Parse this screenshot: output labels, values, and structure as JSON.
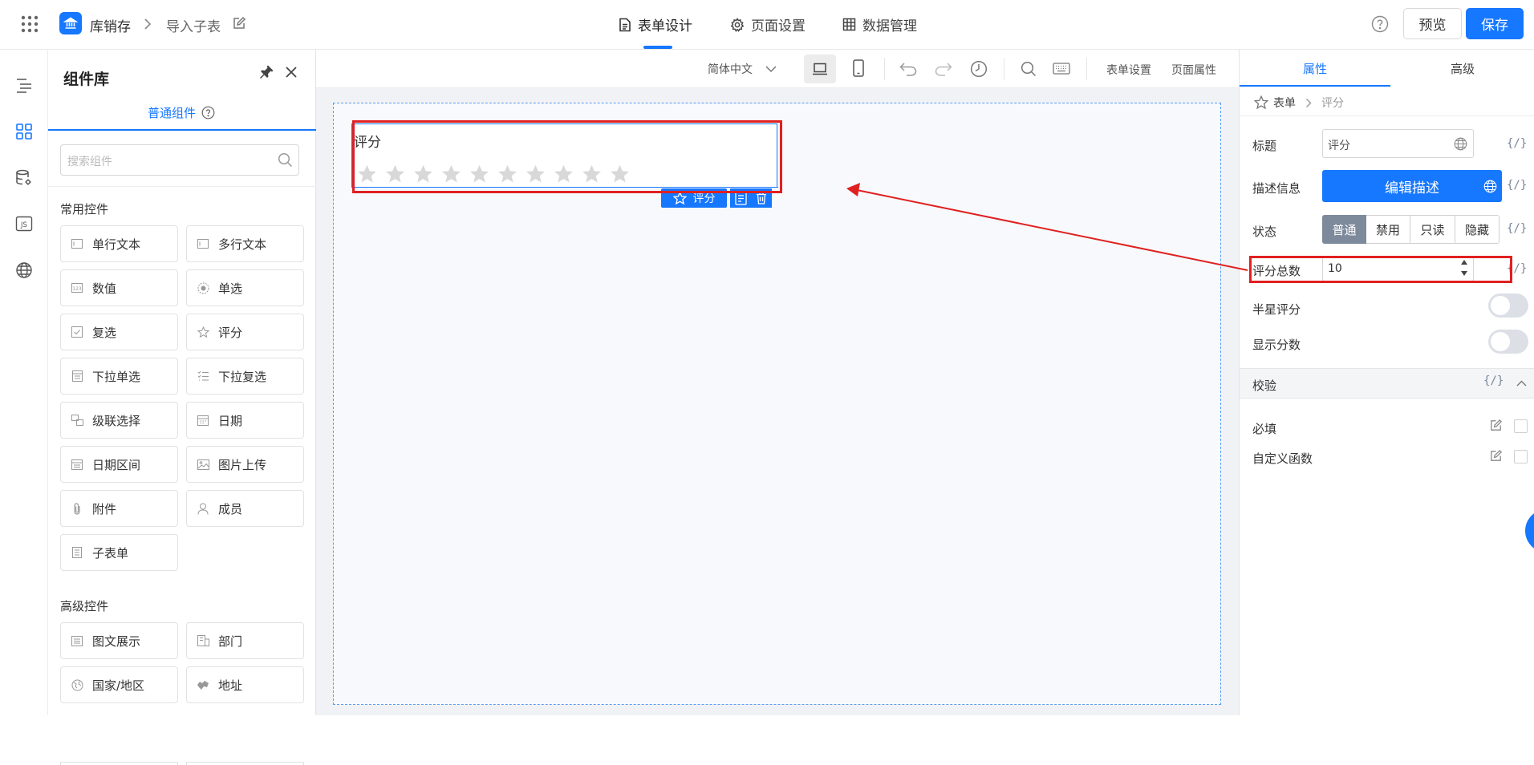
{
  "header": {
    "app_name": "库销存",
    "breadcrumb_page": "导入子表",
    "tabs": [
      {
        "label": "表单设计",
        "icon": "document-icon",
        "active": true
      },
      {
        "label": "页面设置",
        "icon": "gear-icon",
        "active": false
      },
      {
        "label": "数据管理",
        "icon": "table-icon",
        "active": false
      }
    ],
    "preview_label": "预览",
    "save_label": "保存",
    "accent": "#1677ff"
  },
  "library": {
    "title": "组件库",
    "tab_label": "普通组件",
    "search_placeholder": "搜索组件",
    "common_title": "常用控件",
    "common_items": [
      "单行文本",
      "多行文本",
      "数值",
      "单选",
      "复选",
      "评分",
      "下拉单选",
      "下拉复选",
      "级联选择",
      "日期",
      "日期区间",
      "图片上传",
      "附件",
      "成员",
      "子表单"
    ],
    "advanced_title": "高级控件",
    "advanced_items": [
      "图文展示",
      "部门",
      "国家/地区",
      "地址"
    ]
  },
  "toolbar": {
    "language": "简体中文",
    "form_settings": "表单设置",
    "page_props": "页面属性"
  },
  "canvas": {
    "field_label": "评分",
    "star_count": 10,
    "rating_value": 0,
    "tag_label": "评分"
  },
  "props": {
    "tabs": [
      "属性",
      "高级"
    ],
    "breadcrumb_root": "表单",
    "breadcrumb_leaf": "评分",
    "title_label": "标题",
    "title_value": "评分",
    "desc_label": "描述信息",
    "desc_button": "编辑描述",
    "state_label": "状态",
    "state_options": [
      "普通",
      "禁用",
      "只读",
      "隐藏"
    ],
    "state_selected": "普通",
    "total_label": "评分总数",
    "total_value": "10",
    "half_label": "半星评分",
    "half_on": false,
    "show_label": "显示分数",
    "show_on": false,
    "validation_title": "校验",
    "required_label": "必填",
    "custom_fn_label": "自定义函数",
    "code_symbol": "{/}"
  },
  "annotation_color": "#e02020"
}
